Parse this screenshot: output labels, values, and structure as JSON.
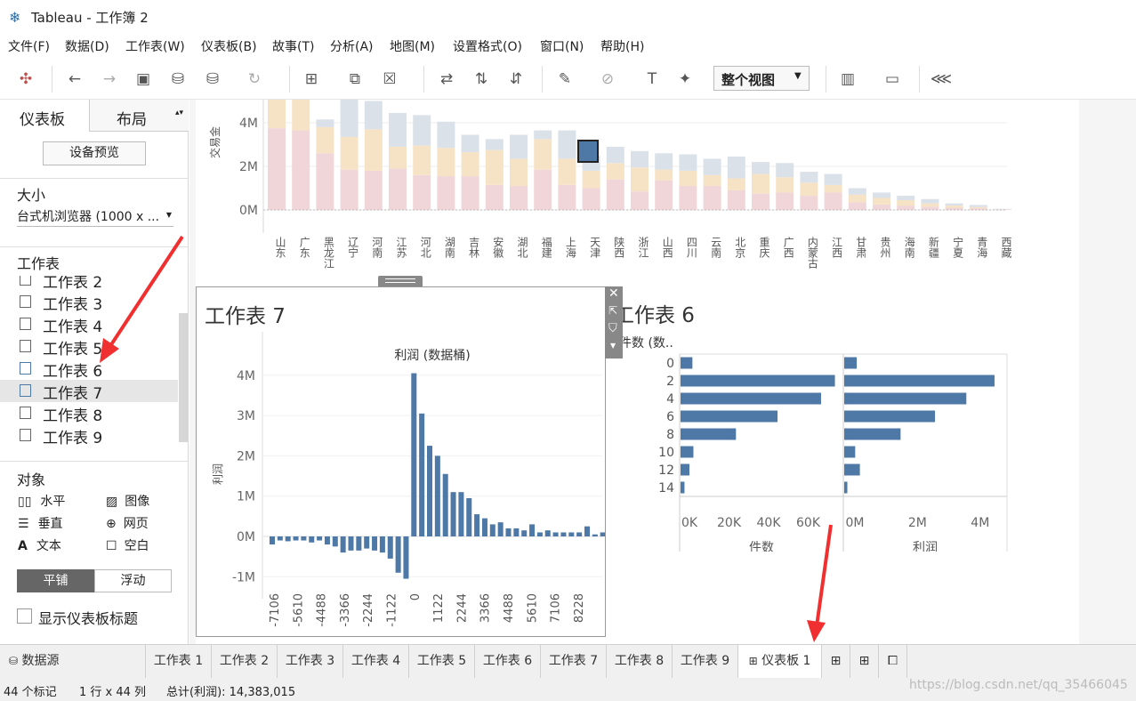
{
  "window": {
    "app_title": "Tableau - 工作簿 2"
  },
  "menu": [
    "文件(F)",
    "数据(D)",
    "工作表(W)",
    "仪表板(B)",
    "故事(T)",
    "分析(A)",
    "地图(M)",
    "设置格式(O)",
    "窗口(N)",
    "帮助(H)"
  ],
  "toolbar": {
    "view_select": "整个视图"
  },
  "left_panel": {
    "tab_dashboard": "仪表板",
    "tab_layout": "布局",
    "device_preview": "设备预览",
    "size_title": "大小",
    "size_value": "台式机浏览器 (1000 x ...",
    "sheets_title": "工作表",
    "sheets": [
      "工作表 2",
      "工作表 3",
      "工作表 4",
      "工作表 5",
      "工作表 6",
      "工作表 7",
      "工作表 8",
      "工作表 9"
    ],
    "objects_title": "对象",
    "objects": [
      "水平",
      "图像",
      "垂直",
      "网页",
      "文本",
      "空白"
    ],
    "tiled": "平铺",
    "floating": "浮动",
    "show_title": "显示仪表板标题"
  },
  "top_chart": {
    "ylabel": "交易金",
    "y_ticks": [
      "4M",
      "2M",
      "0M"
    ],
    "provinces": [
      "山东",
      "广东",
      "黑龙江",
      "辽宁",
      "河南",
      "江苏",
      "河北",
      "湖南",
      "吉林",
      "安徽",
      "湖北",
      "福建",
      "上海",
      "天津",
      "陕西",
      "浙江",
      "山西",
      "四川",
      "云南",
      "北京",
      "重庆",
      "广西",
      "内蒙古",
      "江西",
      "甘肃",
      "贵州",
      "海南",
      "新疆",
      "宁夏",
      "青海",
      "西藏"
    ]
  },
  "sheet7": {
    "title": "工作表 7",
    "chart_title": "利润 (数据桶)",
    "ylabel": "利润",
    "y_ticks": [
      "4M",
      "3M",
      "2M",
      "1M",
      "0M",
      "-1M"
    ],
    "x_ticks": [
      "-7106",
      "-5610",
      "-4488",
      "-3366",
      "-2244",
      "-1122",
      "0",
      "1122",
      "2244",
      "3366",
      "4488",
      "5610",
      "7106",
      "8228"
    ]
  },
  "sheet6": {
    "title": "工作表 6",
    "rows_header": "件数 (数..",
    "rows": [
      "0",
      "2",
      "4",
      "6",
      "8",
      "10",
      "12",
      "14"
    ],
    "left_ticks": [
      "0K",
      "20K",
      "40K",
      "60K"
    ],
    "left_title": "件数",
    "right_ticks": [
      "0M",
      "2M",
      "4M"
    ],
    "right_title": "利润"
  },
  "chart_data": [
    {
      "type": "bar",
      "stacked": true,
      "categories": [
        "山东",
        "广东",
        "黑龙江",
        "辽宁",
        "河南",
        "江苏",
        "河北",
        "湖南",
        "吉林",
        "安徽",
        "湖北",
        "福建",
        "上海",
        "天津",
        "陕西",
        "浙江",
        "山西",
        "四川",
        "云南",
        "北京",
        "重庆",
        "广西",
        "内蒙古",
        "江西",
        "甘肃",
        "贵州",
        "海南",
        "新疆",
        "宁夏",
        "青海",
        "西藏"
      ],
      "series": [
        {
          "values": [
            3.75,
            3.65,
            2.6,
            1.85,
            1.8,
            1.9,
            1.6,
            1.55,
            1.55,
            1.15,
            1.1,
            1.85,
            1.15,
            1.0,
            1.4,
            0.85,
            1.35,
            1.1,
            1.1,
            0.9,
            0.75,
            0.8,
            0.65,
            0.8,
            0.35,
            0.25,
            0.2,
            0.15,
            0.1,
            0.08,
            0.02
          ]
        },
        {
          "values": [
            1.7,
            2.4,
            1.2,
            1.5,
            1.9,
            1.0,
            1.35,
            1.3,
            1.1,
            1.6,
            1.25,
            1.4,
            1.2,
            0.8,
            0.75,
            1.1,
            0.5,
            0.7,
            0.5,
            0.55,
            0.9,
            0.7,
            0.6,
            0.35,
            0.35,
            0.3,
            0.25,
            0.15,
            0.1,
            0.05,
            0.01
          ]
        },
        {
          "values": [
            1.5,
            1.2,
            0.35,
            2.2,
            1.3,
            1.55,
            1.4,
            1.2,
            0.8,
            0.5,
            1.1,
            0.4,
            1.3,
            0.7,
            0.75,
            0.75,
            0.75,
            0.75,
            0.75,
            1.0,
            0.55,
            0.65,
            0.5,
            0.5,
            0.3,
            0.25,
            0.2,
            0.2,
            0.1,
            0.1,
            0.02
          ]
        }
      ],
      "ylim": [
        0,
        5
      ]
    },
    {
      "type": "bar",
      "title": "利润 (数据桶)",
      "ylabel": "利润",
      "values": [
        -0.2,
        -0.1,
        -0.12,
        -0.1,
        -0.1,
        -0.15,
        -0.1,
        -0.2,
        -0.25,
        -0.4,
        -0.35,
        -0.35,
        -0.3,
        -0.35,
        -0.4,
        -0.55,
        -0.9,
        -1.05,
        4.05,
        3.05,
        2.25,
        2.0,
        1.55,
        1.1,
        1.1,
        0.95,
        0.55,
        0.45,
        0.3,
        0.35,
        0.2,
        0.2,
        0.15,
        0.3,
        0.1,
        0.15,
        0.1,
        0.1,
        0.1,
        0.1,
        0.25,
        0.05,
        0.1
      ],
      "ylim": [
        -1.2,
        4.3
      ]
    },
    {
      "type": "bar",
      "orientation": "horizontal",
      "categories": [
        "0",
        "2",
        "4",
        "6",
        "8",
        "10",
        "12",
        "14"
      ],
      "series": [
        {
          "name": "件数",
          "values": [
            6000,
            78000,
            71000,
            49000,
            28000,
            6500,
            4500,
            2000
          ]
        },
        {
          "name": "利润",
          "values": [
            0.4,
            4.8,
            3.9,
            2.9,
            1.8,
            0.35,
            0.5,
            0.1
          ]
        }
      ]
    }
  ],
  "tabs": {
    "datasource": "数据源",
    "sheets": [
      "工作表 1",
      "工作表 2",
      "工作表 3",
      "工作表 4",
      "工作表 5",
      "工作表 6",
      "工作表 7",
      "工作表 8",
      "工作表 9"
    ],
    "dashboard": "仪表板 1"
  },
  "status": {
    "marks": "44 个标记",
    "dims": "1 行 x 44 列",
    "total": "总计(利润): 14,383,015",
    "watermark": "https://blog.csdn.net/qq_35466045"
  },
  "colors": {
    "accent": "#4e79a7",
    "tan": "#f6e3c6",
    "pink": "#f1d6d9",
    "gray": "#dbe1e8"
  }
}
